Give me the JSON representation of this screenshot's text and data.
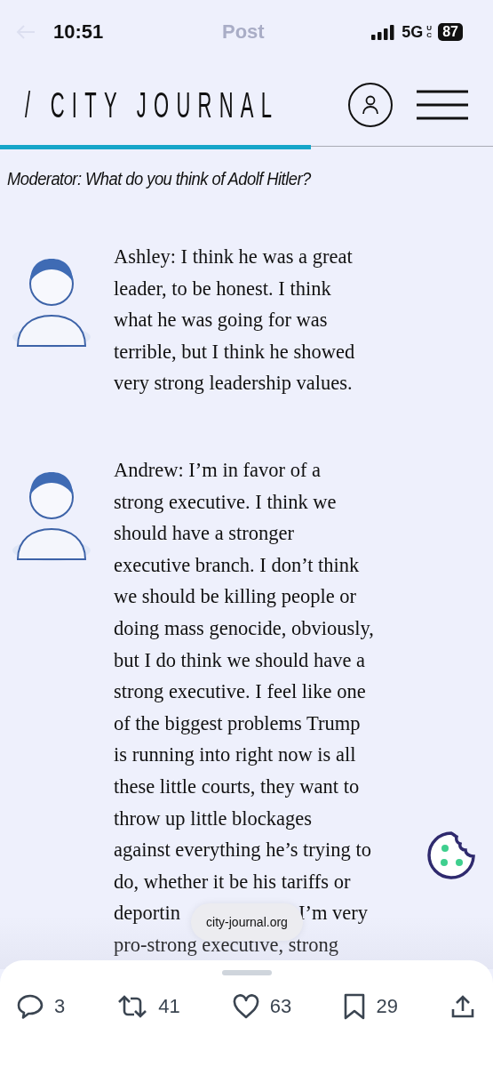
{
  "status_bar": {
    "time": "10:51",
    "title": "Post",
    "network": "5G",
    "network_sub": "UC",
    "battery": "87"
  },
  "header": {
    "logo": "/ CITY JOURNAL"
  },
  "reading_progress": {
    "level": 0.63
  },
  "moderator_question": "Moderator: What do you think of Adolf Hitler?",
  "answers": [
    {
      "lines": [
        [
          "Ashley: I think he was a great"
        ],
        [
          "leader, to be honest. I think"
        ],
        [
          "what he was going for was"
        ],
        [
          "terrible, but I think he showed"
        ],
        [
          "very strong leadership values."
        ]
      ]
    },
    {
      "lines": [
        [
          "Andrew: I’m in favor of a"
        ],
        [
          "strong executive. I think we"
        ],
        [
          "should have a stronger"
        ],
        [
          "executive branch. I don’t think"
        ],
        [
          "we should be killing people or"
        ],
        [
          "doing mass genocide, obviously,"
        ],
        [
          "but I do think we should have a"
        ],
        [
          "strong executive. I feel like one"
        ],
        [
          "of the biggest problems Trump"
        ],
        [
          "is running into right now is all"
        ],
        [
          "these little courts, they want to"
        ],
        [
          "throw up little blockages"
        ],
        [
          "against everything he’s trying to"
        ],
        [
          "do, whether it be his tariffs or"
        ],
        [
          "deportin",
          "I’m very"
        ],
        [
          "pro-strong executive, strong"
        ]
      ]
    }
  ],
  "url_pill": "city-journal.org",
  "actions": [
    {
      "kind": "reply",
      "count": "3"
    },
    {
      "kind": "repost",
      "count": "41"
    },
    {
      "kind": "like",
      "count": "63"
    },
    {
      "kind": "bookmark",
      "count": "29"
    },
    {
      "kind": "share"
    }
  ]
}
